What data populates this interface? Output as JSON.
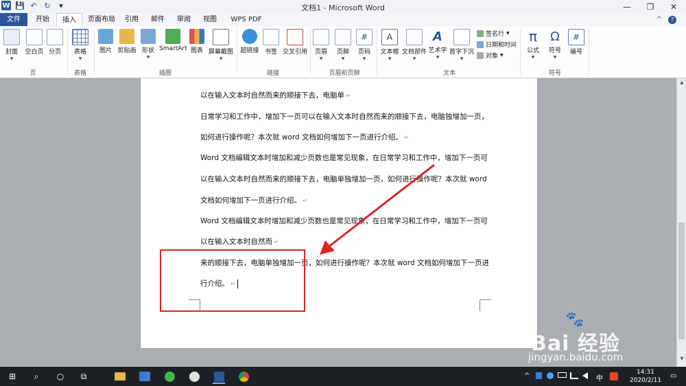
{
  "window": {
    "title": "文档1 - Microsoft Word",
    "minimize": "—",
    "restore": "❐",
    "close": "✕",
    "help": "?"
  },
  "qat": {
    "word_logo": "W",
    "save": "💾",
    "undo": "↶",
    "redo": "↻",
    "more": "▾"
  },
  "tabs": [
    "文件",
    "开始",
    "插入",
    "页面布局",
    "引用",
    "邮件",
    "审阅",
    "视图",
    "WPS PDF"
  ],
  "ribbon": {
    "collapse": "^",
    "groups": {
      "page": "页",
      "table": "表格",
      "illustrations": "插图",
      "links": "链接",
      "header_footer": "页眉和页脚",
      "text": "文本",
      "symbols": "符号"
    },
    "buttons": {
      "cover": "封面",
      "blank_page": "空白页",
      "page_break": "分页",
      "table": "表格",
      "picture": "图片",
      "clip_art": "剪贴画",
      "shapes": "形状",
      "smartart": "SmartArt",
      "chart": "图表",
      "screenshot": "屏幕截图",
      "hyperlink": "超链接",
      "bookmark": "书签",
      "cross_reference": "交叉引用",
      "header": "页眉",
      "footer": "页脚",
      "page_number": "页码",
      "text_box": "文本框",
      "quick_parts": "文档部件",
      "wordart": "艺术字",
      "drop_cap": "首字下沉",
      "signature_line": "签名行",
      "date_time": "日期和时间",
      "object": "对象",
      "equation": "公式",
      "symbol": "符号",
      "number": "编号"
    },
    "glyphs": {
      "equation": "π",
      "symbol": "Ω",
      "number": "#",
      "text_box": "A",
      "wordart": "A"
    }
  },
  "document": {
    "lines": [
      "以在输入文本时自然而来的顺接下去，电脑单",
      "日常学习和工作中，增加下一页可以在输入文本时自然而来的顺接下去，电脑独增加一页，",
      "如何进行操作呢？本次就 word 文档如何增加下一页进行介绍。",
      "Word 文档编辑文本时增加和减少页数也是常见现象，在日常学习和工作中，增加下一页可",
      "以在输入文本时自然而来的顺接下去，电脑单独增加一页，如何进行操作呢？本次就 word",
      "文档如何增加下一页进行介绍。",
      "Word 文档编辑文本时增加和减少页数也是常见现象，在日常学习和工作中，增加下一页可",
      "以在输入文本时自然而",
      "来的顺接下去，电脑单独增加一页，如何进行操作呢？本次就 word 文档如何增加下一页进",
      "行介绍。"
    ],
    "paragraph_mark": "↵"
  },
  "watermark": {
    "brand": "Bai 经验",
    "url": "jingyan.baidu.com",
    "paw": "🐾"
  },
  "taskbar": {
    "start": "⊞",
    "search": "⌕",
    "cortana": "○",
    "taskview": "⧉",
    "time": "14:31",
    "date": "2020/2/11",
    "ime": "中",
    "tray_up": "^",
    "notifications": "▭"
  },
  "colors": {
    "accent": "#2b579a",
    "red": "#e02424"
  }
}
